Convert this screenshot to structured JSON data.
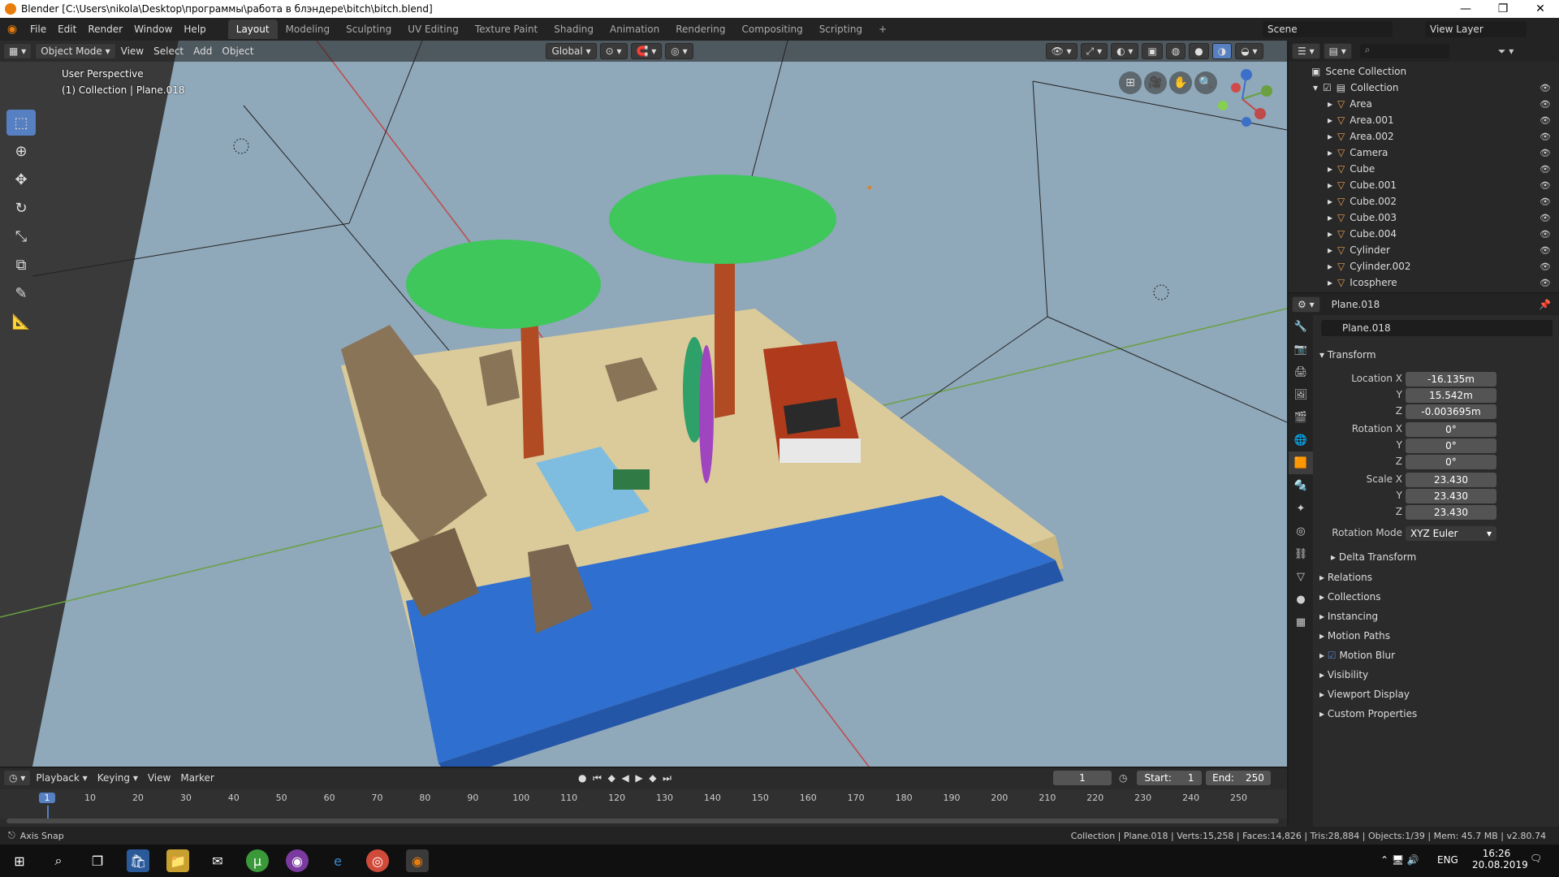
{
  "window": {
    "title": "Blender [C:\\Users\\nikola\\Desktop\\программы\\работа в блэндере\\bitch\\bitch.blend]"
  },
  "menu": [
    "File",
    "Edit",
    "Render",
    "Window",
    "Help"
  ],
  "workspaces": [
    "Layout",
    "Modeling",
    "Sculpting",
    "UV Editing",
    "Texture Paint",
    "Shading",
    "Animation",
    "Rendering",
    "Compositing",
    "Scripting",
    "+"
  ],
  "scene": {
    "label": "Scene"
  },
  "view_layer": {
    "label": "View Layer"
  },
  "viewport_header": {
    "mode": "Object Mode",
    "menus": [
      "View",
      "Select",
      "Add",
      "Object"
    ],
    "orientation": "Global"
  },
  "viewport": {
    "perspective": "User Perspective",
    "collection_info": "(1) Collection | Plane.018"
  },
  "colors": {
    "accent": "#5680c2",
    "sky": "#8fa8ba",
    "sand": "#dccb9a",
    "water": "#2e6fd0",
    "palm": "#3fc75c"
  },
  "outliner": {
    "root": "Scene Collection",
    "collection": "Collection",
    "items": [
      "Area",
      "Area.001",
      "Area.002",
      "Camera",
      "Cube",
      "Cube.001",
      "Cube.002",
      "Cube.003",
      "Cube.004",
      "Cylinder",
      "Cylinder.002",
      "Icosphere"
    ]
  },
  "properties": {
    "object_name": "Plane.018",
    "data_name": "Plane.018",
    "transform_title": "Transform",
    "location_label": "Location X",
    "rotation_label": "Rotation X",
    "scale_label": "Scale X",
    "y_label": "Y",
    "z_label": "Z",
    "location": [
      "-16.135m",
      "15.542m",
      "-0.003695m"
    ],
    "rotation": [
      "0°",
      "0°",
      "0°"
    ],
    "scale": [
      "23.430",
      "23.430",
      "23.430"
    ],
    "rotation_mode_label": "Rotation Mode",
    "rotation_mode": "XYZ Euler",
    "delta_transform": "Delta Transform",
    "sections": [
      "Relations",
      "Collections",
      "Instancing",
      "Motion Paths",
      "Motion Blur",
      "Visibility",
      "Viewport Display",
      "Custom Properties"
    ]
  },
  "timeline": {
    "menus": [
      "Playback",
      "Keying",
      "View",
      "Marker"
    ],
    "current_frame": "1",
    "start_label": "Start:",
    "start": "1",
    "end_label": "End:",
    "end": "250",
    "ruler": [
      "1",
      "10",
      "20",
      "30",
      "40",
      "50",
      "60",
      "70",
      "80",
      "90",
      "100",
      "110",
      "120",
      "130",
      "140",
      "150",
      "160",
      "170",
      "180",
      "190",
      "200",
      "210",
      "220",
      "230",
      "240",
      "250"
    ]
  },
  "statusbar": {
    "left": "Axis Snap",
    "right": "Collection | Plane.018 | Verts:15,258 | Faces:14,826 | Tris:28,884 | Objects:1/39 | Mem: 45.7 MB | v2.80.74"
  },
  "taskbar": {
    "lang": "ENG",
    "time": "16:26",
    "date": "20.08.2019"
  }
}
